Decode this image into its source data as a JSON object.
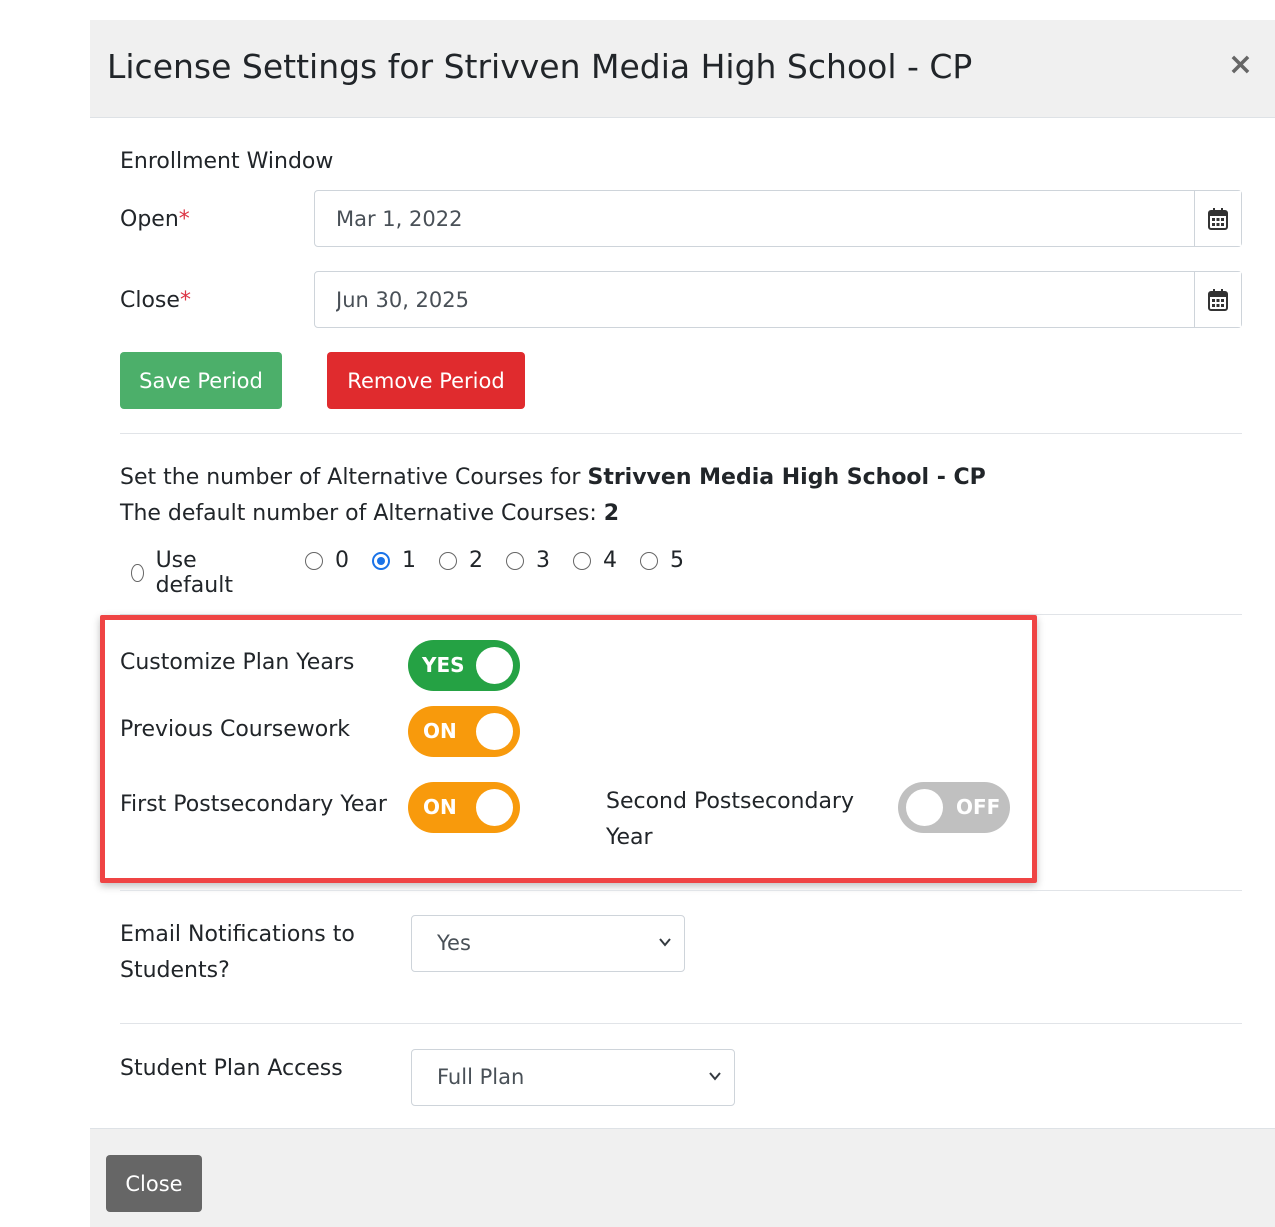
{
  "header": {
    "title": "License Settings for Strivven Media High School - CP",
    "close_symbol": "×"
  },
  "enrollment": {
    "section_label": "Enrollment Window",
    "open_label": "Open",
    "open_value": "Mar 1, 2022",
    "close_label": "Close",
    "close_value": "Jun 30, 2025",
    "required_mark": "*",
    "save_label": "Save Period",
    "remove_label": "Remove Period"
  },
  "alternatives": {
    "intro_text": "Set the number of Alternative Courses for ",
    "school_name": "Strivven Media High School - CP",
    "default_text": "The default number of Alternative Courses: ",
    "default_value": "2",
    "options": [
      "Use default",
      "0",
      "1",
      "2",
      "3",
      "4",
      "5"
    ],
    "selected": "1"
  },
  "plan_years": {
    "customize_label": "Customize Plan Years",
    "customize_state": "YES",
    "previous_label": "Previous Coursework",
    "previous_state": "ON",
    "first_label": "First Postsecondary Year",
    "first_state": "ON",
    "second_label_line1": "Second Postsecondary",
    "second_label_line2": "Year",
    "second_state": "OFF"
  },
  "email": {
    "label_line1": "Email Notifications to",
    "label_line2": "Students?",
    "value": "Yes"
  },
  "access": {
    "label": "Student Plan Access",
    "value": "Full Plan"
  },
  "footer": {
    "close_label": "Close"
  },
  "colors": {
    "toggle_yes": "#25a244",
    "toggle_on": "#f89a0c",
    "toggle_off": "#c0c0c0",
    "save_button": "#4caf6a",
    "remove_button": "#e02b2e",
    "highlight_border": "#ef4444",
    "radio_checked": "#1a73e8"
  }
}
